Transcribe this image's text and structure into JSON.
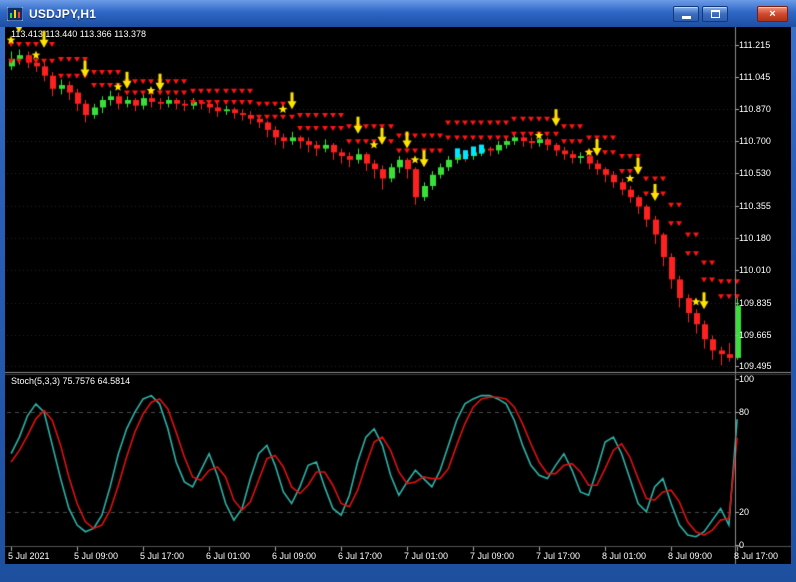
{
  "window": {
    "title": "USDJPY,H1",
    "close_glyph": "×"
  },
  "chart": {
    "ohlc_readout": "113.413 113.440 113.366 113.378",
    "price_axis_labels": [
      "111.215",
      "111.045",
      "110.870",
      "110.700",
      "110.530",
      "110.355",
      "110.180",
      "110.010",
      "109.835",
      "109.665",
      "109.495"
    ],
    "time_axis_labels": [
      "5 Jul 2021",
      "5 Jul 09:00",
      "5 Jul 17:00",
      "6 Jul 01:00",
      "6 Jul 09:00",
      "6 Jul 17:00",
      "7 Jul 01:00",
      "7 Jul 09:00",
      "7 Jul 17:00",
      "8 Jul 01:00",
      "8 Jul 09:00",
      "8 Jul 17:00"
    ],
    "stoch_label": "Stoch(5,3,3) 75.7576 64.5814",
    "stoch_axis_labels": [
      "100",
      "80",
      "20",
      "0"
    ]
  },
  "colors": {
    "bull": "#38e038",
    "bear": "#ff2020",
    "band": "#ff1414",
    "arrow": "#ffe400",
    "star": "#ffe400",
    "cyan": "#00e8ff",
    "stoch_main": "#2fb3a9",
    "stoch_signal": "#e01212",
    "grid": "#242424",
    "stoch_grid": "#4a4a4a",
    "divider": "#8c8c8c",
    "tick": "#aaaaaa",
    "axis_text": "#ffffff",
    "frame": "#2a60b8"
  },
  "chart_data": {
    "type": "candlestick",
    "symbol": "USDJPY",
    "timeframe": "H1",
    "title": "USDJPY,H1",
    "price_range": [
      109.47,
      111.3
    ],
    "bars_per_tick": 8,
    "candles": [
      [
        111.1,
        111.18,
        111.08,
        111.14
      ],
      [
        111.14,
        111.19,
        111.11,
        111.16
      ],
      [
        111.16,
        111.18,
        111.09,
        111.12
      ],
      [
        111.12,
        111.15,
        111.07,
        111.1
      ],
      [
        111.1,
        111.12,
        111.02,
        111.05
      ],
      [
        111.05,
        111.07,
        110.94,
        110.98
      ],
      [
        110.98,
        111.03,
        110.95,
        111.0
      ],
      [
        111.0,
        111.02,
        110.92,
        110.96
      ],
      [
        110.96,
        110.98,
        110.86,
        110.9
      ],
      [
        110.9,
        110.92,
        110.8,
        110.84
      ],
      [
        110.84,
        110.9,
        110.82,
        110.88
      ],
      [
        110.88,
        110.94,
        110.85,
        110.92
      ],
      [
        110.92,
        110.97,
        110.89,
        110.94
      ],
      [
        110.94,
        110.96,
        110.87,
        110.9
      ],
      [
        110.9,
        110.94,
        110.88,
        110.92
      ],
      [
        110.92,
        110.93,
        110.86,
        110.89
      ],
      [
        110.89,
        110.95,
        110.87,
        110.93
      ],
      [
        110.93,
        110.95,
        110.88,
        110.91
      ],
      [
        110.91,
        110.93,
        110.87,
        110.9
      ],
      [
        110.9,
        110.94,
        110.88,
        110.92
      ],
      [
        110.92,
        110.93,
        110.87,
        110.9
      ],
      [
        110.9,
        110.92,
        110.86,
        110.89
      ],
      [
        110.89,
        110.93,
        110.87,
        110.91
      ],
      [
        110.91,
        110.92,
        110.87,
        110.9
      ],
      [
        110.9,
        110.91,
        110.85,
        110.88
      ],
      [
        110.88,
        110.9,
        110.83,
        110.86
      ],
      [
        110.86,
        110.89,
        110.84,
        110.87
      ],
      [
        110.87,
        110.88,
        110.82,
        110.85
      ],
      [
        110.85,
        110.87,
        110.81,
        110.84
      ],
      [
        110.84,
        110.86,
        110.79,
        110.82
      ],
      [
        110.82,
        110.84,
        110.77,
        110.8
      ],
      [
        110.8,
        110.81,
        110.72,
        110.76
      ],
      [
        110.76,
        110.78,
        110.68,
        110.72
      ],
      [
        110.72,
        110.74,
        110.66,
        110.7
      ],
      [
        110.7,
        110.75,
        110.68,
        110.72
      ],
      [
        110.72,
        110.73,
        110.66,
        110.7
      ],
      [
        110.7,
        110.72,
        110.64,
        110.68
      ],
      [
        110.68,
        110.7,
        110.62,
        110.66
      ],
      [
        110.66,
        110.71,
        110.64,
        110.68
      ],
      [
        110.68,
        110.69,
        110.6,
        110.64
      ],
      [
        110.64,
        110.66,
        110.58,
        110.62
      ],
      [
        110.62,
        110.64,
        110.56,
        110.6
      ],
      [
        110.6,
        110.66,
        110.58,
        110.63
      ],
      [
        110.63,
        110.64,
        110.54,
        110.58
      ],
      [
        110.58,
        110.6,
        110.5,
        110.55
      ],
      [
        110.55,
        110.57,
        110.44,
        110.5
      ],
      [
        110.5,
        110.58,
        110.48,
        110.56
      ],
      [
        110.56,
        110.62,
        110.53,
        110.6
      ],
      [
        110.6,
        110.61,
        110.5,
        110.55
      ],
      [
        110.55,
        110.56,
        110.36,
        110.4
      ],
      [
        110.4,
        110.48,
        110.38,
        110.46
      ],
      [
        110.46,
        110.54,
        110.44,
        110.52
      ],
      [
        110.52,
        110.58,
        110.5,
        110.56
      ],
      [
        110.56,
        110.62,
        110.54,
        110.6
      ],
      [
        110.6,
        110.65,
        110.58,
        110.63
      ],
      [
        110.63,
        110.65,
        110.59,
        110.62
      ],
      [
        110.62,
        110.66,
        110.6,
        110.64
      ],
      [
        110.64,
        110.68,
        110.62,
        110.66
      ],
      [
        110.66,
        110.67,
        110.62,
        110.65
      ],
      [
        110.65,
        110.7,
        110.63,
        110.68
      ],
      [
        110.68,
        110.72,
        110.66,
        110.7
      ],
      [
        110.7,
        110.74,
        110.68,
        110.72
      ],
      [
        110.72,
        110.73,
        110.67,
        110.7
      ],
      [
        110.7,
        110.72,
        110.66,
        110.69
      ],
      [
        110.69,
        110.73,
        110.67,
        110.71
      ],
      [
        110.71,
        110.72,
        110.65,
        110.68
      ],
      [
        110.68,
        110.69,
        110.62,
        110.65
      ],
      [
        110.65,
        110.67,
        110.6,
        110.63
      ],
      [
        110.63,
        110.65,
        110.58,
        110.61
      ],
      [
        110.61,
        110.64,
        110.58,
        110.62
      ],
      [
        110.62,
        110.63,
        110.55,
        110.58
      ],
      [
        110.58,
        110.6,
        110.52,
        110.55
      ],
      [
        110.55,
        110.56,
        110.48,
        110.52
      ],
      [
        110.52,
        110.54,
        110.45,
        110.48
      ],
      [
        110.48,
        110.5,
        110.41,
        110.44
      ],
      [
        110.44,
        110.46,
        110.37,
        110.4
      ],
      [
        110.4,
        110.41,
        110.31,
        110.35
      ],
      [
        110.35,
        110.36,
        110.24,
        110.28
      ],
      [
        110.28,
        110.3,
        110.15,
        110.2
      ],
      [
        110.2,
        110.21,
        110.03,
        110.08
      ],
      [
        110.08,
        110.1,
        109.91,
        109.96
      ],
      [
        109.96,
        109.98,
        109.81,
        109.86
      ],
      [
        109.86,
        109.88,
        109.73,
        109.78
      ],
      [
        109.78,
        109.8,
        109.67,
        109.72
      ],
      [
        109.72,
        109.74,
        109.59,
        109.64
      ],
      [
        109.64,
        109.66,
        109.53,
        109.58
      ],
      [
        109.58,
        109.6,
        109.5,
        109.56
      ],
      [
        109.56,
        109.62,
        109.52,
        109.54
      ],
      [
        109.54,
        109.86,
        109.53,
        109.82
      ]
    ],
    "band_upper": [
      111.22,
      111.22,
      111.22,
      111.22,
      111.22,
      111.22,
      111.14,
      111.14,
      111.14,
      111.14,
      111.07,
      111.07,
      111.07,
      111.07,
      111.02,
      111.02,
      111.02,
      111.02,
      111.02,
      111.02,
      111.02,
      111.02,
      110.97,
      110.97,
      110.97,
      110.97,
      110.97,
      110.97,
      110.97,
      110.97,
      110.9,
      110.9,
      110.9,
      110.9,
      110.9,
      110.84,
      110.84,
      110.84,
      110.84,
      110.84,
      110.84,
      110.78,
      110.78,
      110.78,
      110.78,
      110.78,
      110.78,
      110.73,
      110.73,
      110.73,
      110.73,
      110.73,
      110.73,
      110.8,
      110.8,
      110.8,
      110.8,
      110.8,
      110.8,
      110.8,
      110.8,
      110.82,
      110.82,
      110.82,
      110.82,
      110.82,
      110.82,
      110.78,
      110.78,
      110.78,
      110.72,
      110.72,
      110.72,
      110.72,
      110.62,
      110.62,
      110.62,
      110.5,
      110.5,
      110.5,
      110.36,
      110.36,
      110.2,
      110.2,
      110.05,
      110.05,
      109.95,
      109.95,
      109.95
    ],
    "band_lower": [
      111.13,
      111.13,
      111.13,
      111.13,
      111.13,
      111.13,
      111.05,
      111.05,
      111.05,
      111.05,
      111.0,
      111.0,
      111.0,
      111.0,
      110.96,
      110.96,
      110.96,
      110.96,
      110.96,
      110.96,
      110.96,
      110.96,
      110.91,
      110.91,
      110.91,
      110.91,
      110.91,
      110.91,
      110.91,
      110.91,
      110.83,
      110.83,
      110.83,
      110.83,
      110.83,
      110.77,
      110.77,
      110.77,
      110.77,
      110.77,
      110.77,
      110.7,
      110.7,
      110.7,
      110.7,
      110.7,
      110.7,
      110.65,
      110.65,
      110.65,
      110.65,
      110.65,
      110.65,
      110.72,
      110.72,
      110.72,
      110.72,
      110.72,
      110.72,
      110.72,
      110.72,
      110.74,
      110.74,
      110.74,
      110.74,
      110.74,
      110.74,
      110.7,
      110.7,
      110.7,
      110.64,
      110.64,
      110.64,
      110.64,
      110.54,
      110.54,
      110.54,
      110.42,
      110.42,
      110.42,
      110.26,
      110.26,
      110.1,
      110.1,
      109.96,
      109.96,
      109.87,
      109.87,
      109.87
    ],
    "arrows_down": [
      {
        "bar": 1,
        "price": 111.28
      },
      {
        "bar": 4,
        "price": 111.2
      },
      {
        "bar": 9,
        "price": 111.04
      },
      {
        "bar": 14,
        "price": 110.98
      },
      {
        "bar": 18,
        "price": 110.97
      },
      {
        "bar": 34,
        "price": 110.87
      },
      {
        "bar": 42,
        "price": 110.74
      },
      {
        "bar": 45,
        "price": 110.68
      },
      {
        "bar": 48,
        "price": 110.66
      },
      {
        "bar": 50,
        "price": 110.56
      },
      {
        "bar": 66,
        "price": 110.78
      },
      {
        "bar": 71,
        "price": 110.62
      },
      {
        "bar": 76,
        "price": 110.52
      },
      {
        "bar": 78,
        "price": 110.38
      },
      {
        "bar": 84,
        "price": 109.8
      }
    ],
    "stars": [
      {
        "bar": 0,
        "price": 111.24
      },
      {
        "bar": 3,
        "price": 111.16
      },
      {
        "bar": 13,
        "price": 110.99
      },
      {
        "bar": 17,
        "price": 110.97
      },
      {
        "bar": 33,
        "price": 110.87
      },
      {
        "bar": 44,
        "price": 110.68
      },
      {
        "bar": 49,
        "price": 110.6
      },
      {
        "bar": 64,
        "price": 110.73
      },
      {
        "bar": 70,
        "price": 110.64
      },
      {
        "bar": 75,
        "price": 110.5
      },
      {
        "bar": 83,
        "price": 109.84
      }
    ],
    "cyan_markers": [
      {
        "bar": 54,
        "price": 110.64
      },
      {
        "bar": 55,
        "price": 110.63
      },
      {
        "bar": 56,
        "price": 110.65
      },
      {
        "bar": 57,
        "price": 110.66
      }
    ],
    "stochastic": {
      "name": "Stoch(5,3,3)",
      "values_shown": [
        75.7576,
        64.5814
      ],
      "range": [
        0,
        100
      ],
      "grid_levels": [
        20,
        80
      ],
      "main": [
        55,
        65,
        78,
        85,
        80,
        60,
        40,
        22,
        12,
        8,
        10,
        18,
        35,
        55,
        70,
        80,
        88,
        90,
        85,
        70,
        50,
        38,
        35,
        45,
        55,
        42,
        25,
        15,
        22,
        40,
        55,
        60,
        48,
        32,
        25,
        35,
        48,
        50,
        35,
        22,
        18,
        30,
        50,
        65,
        70,
        60,
        42,
        30,
        38,
        45,
        40,
        35,
        45,
        60,
        75,
        85,
        88,
        90,
        90,
        88,
        85,
        75,
        60,
        48,
        42,
        40,
        48,
        55,
        45,
        32,
        30,
        45,
        62,
        65,
        55,
        40,
        25,
        20,
        35,
        40,
        25,
        12,
        6,
        5,
        8,
        15,
        22,
        12,
        75.76
      ],
      "signal": [
        50,
        57,
        66,
        76,
        81,
        75,
        60,
        41,
        25,
        14,
        10,
        12,
        21,
        36,
        53,
        68,
        79,
        86,
        88,
        82,
        68,
        53,
        41,
        39,
        45,
        47,
        41,
        27,
        21,
        26,
        39,
        52,
        54,
        47,
        35,
        31,
        36,
        44,
        44,
        36,
        25,
        23,
        33,
        48,
        62,
        65,
        57,
        44,
        37,
        38,
        41,
        40,
        40,
        46,
        60,
        73,
        83,
        88,
        89,
        89,
        88,
        83,
        73,
        61,
        50,
        43,
        43,
        48,
        49,
        44,
        36,
        36,
        46,
        57,
        61,
        53,
        40,
        28,
        27,
        32,
        33,
        26,
        14,
        8,
        6,
        9,
        15,
        16,
        64.58
      ]
    }
  }
}
